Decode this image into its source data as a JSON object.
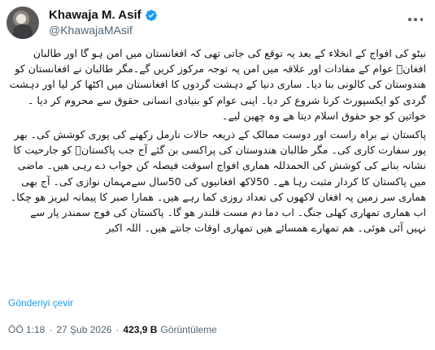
{
  "author": {
    "name": "Khawaja M. Asif",
    "handle": "@KhawajaMAsif"
  },
  "tweet": {
    "paragraphs": [
      "نیٹو کی افواج کے انخلاء کے بعد یہ توقع کی جاتی تھی کہ افغانستان میں امن ہو گا اور طالبان افغانؑ عوام کے مفادات اور علاقہ میں امن پہ توجہ مرکوز کریں گے۔مگر طالبان نے افغانستان کو ھندوستان کی کالونی بنا دیا۔ ساری دنیا کے دہشت گردوں کا افغانستان میں اکٹھا کر لیا اور دہشت گردی کو ایکسپورٹ کرنا شروع کر دیا۔ اپنی عوام کو بنیادی انسانی حقوق سے محروم کر دیا ۔ خواتین کو جو حقوق اسلام دیتا ھے وہ چھین لیے۔",
      "پاکستان نے براہ راست اور دوست ممالک کے ذریعہ حالات نارمل رکھنے کی پوری کوشش کی۔ بھر پور سفارت کاری کی۔ مگر طالبان ھندوستان کی پراکسی بن گئے آج جب پاکستانؑ کو جارحیت کا نشانہ بنانے کی کوشش کی الحمدللہ ھماری افواج اسوقت فیصلہ کن جواب دے رہی ھیں۔ ماضی میں پاکستان کا کردار مثبت رہا ھے۔ 50لاکھ افغانیوں کی 50سال سےمہمان نوازی کی۔ آج بھی ھماری سر زمین پہ افغان لاکھوں کی تعداد روزی کما رہے ھیں۔ ھمارا صبر کا پیمانہ لبریز ھو چکا۔ اب ھماری تمھاری کھلی جنگ۔ اب دما دم مست قلندر ھو گا۔ پاکستان کی فوج سمندر پار سے نہیں آئی ھوئی۔ ھم تمھارے ھمسائے ھیں تمھاری اوقات جانتے ھیں۔ اللہ اکبر"
    ],
    "translate_label": "Gönderiyi çevir",
    "time": "ÖÖ 1:18",
    "date": "27 Şub 2026",
    "views_count": "423,9 B",
    "views_label": "Görüntüleme"
  },
  "colors": {
    "link": "#1d9bf0",
    "secondary_text": "#536471",
    "primary_text": "#0f1419",
    "verified_badge": "#1d9bf0"
  },
  "icons": {
    "verified": "verified-badge-icon",
    "more": "more-options-icon"
  }
}
